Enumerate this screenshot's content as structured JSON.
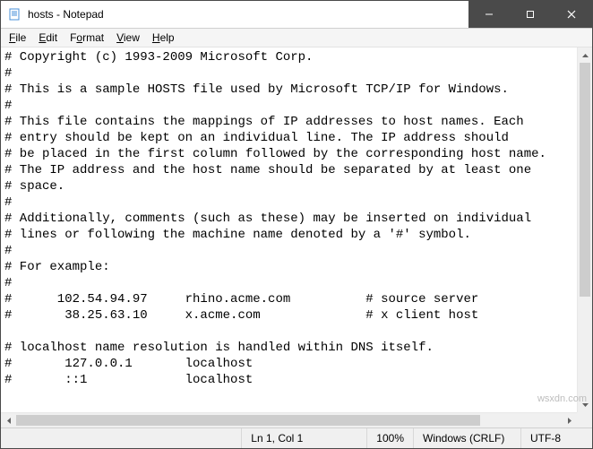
{
  "title": "hosts - Notepad",
  "menu": {
    "file": "File",
    "edit": "Edit",
    "format": "Format",
    "view": "View",
    "help": "Help"
  },
  "content_lines": [
    "# Copyright (c) 1993-2009 Microsoft Corp.",
    "#",
    "# This is a sample HOSTS file used by Microsoft TCP/IP for Windows.",
    "#",
    "# This file contains the mappings of IP addresses to host names. Each",
    "# entry should be kept on an individual line. The IP address should",
    "# be placed in the first column followed by the corresponding host name.",
    "# The IP address and the host name should be separated by at least one",
    "# space.",
    "#",
    "# Additionally, comments (such as these) may be inserted on individual",
    "# lines or following the machine name denoted by a '#' symbol.",
    "#",
    "# For example:",
    "#",
    "#      102.54.94.97     rhino.acme.com          # source server",
    "#       38.25.63.10     x.acme.com              # x client host",
    "",
    "# localhost name resolution is handled within DNS itself.",
    "#       127.0.0.1       localhost",
    "#       ::1             localhost"
  ],
  "status": {
    "position": "Ln 1, Col 1",
    "zoom": "100%",
    "line_ending": "Windows (CRLF)",
    "encoding": "UTF-8"
  },
  "watermark": "wsxdn.com"
}
